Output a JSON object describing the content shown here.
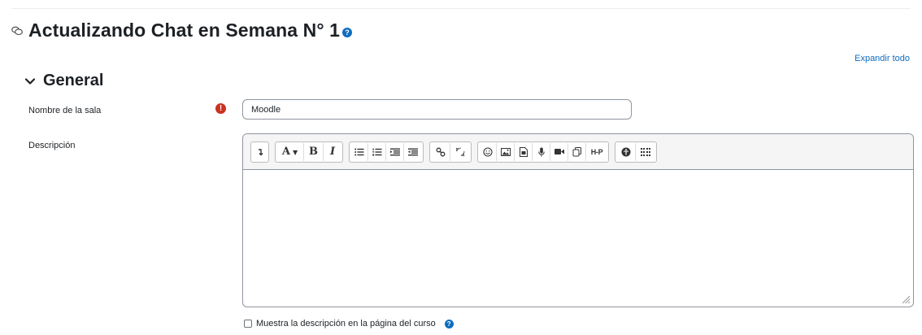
{
  "page": {
    "title": "Actualizando Chat en Semana N° 1",
    "title_icon": "chat-icon",
    "help_icon": "question-circle-icon"
  },
  "expand_all_label": "Expandir todo",
  "section": {
    "title": "General",
    "toggle_icon": "chevron-down-icon"
  },
  "fields": {
    "name": {
      "label": "Nombre de la sala",
      "value": "Moodle",
      "required_icon": "exclamation-circle-icon"
    },
    "description": {
      "label": "Descripción",
      "value": ""
    }
  },
  "editor_toolbar": {
    "groups": [
      [
        {
          "name": "collapse-toolbar-icon",
          "text": "↴"
        }
      ],
      [
        {
          "name": "font-style-icon",
          "text": "A▾"
        },
        {
          "name": "bold-icon",
          "text": "B"
        },
        {
          "name": "italic-icon",
          "text": "I"
        }
      ],
      [
        {
          "name": "unordered-list-icon"
        },
        {
          "name": "ordered-list-icon"
        },
        {
          "name": "outdent-icon"
        },
        {
          "name": "indent-icon"
        }
      ],
      [
        {
          "name": "link-icon"
        },
        {
          "name": "unlink-icon"
        }
      ],
      [
        {
          "name": "emoji-icon"
        },
        {
          "name": "image-icon"
        },
        {
          "name": "media-icon"
        },
        {
          "name": "record-audio-icon"
        },
        {
          "name": "record-video-icon"
        },
        {
          "name": "manage-files-icon"
        },
        {
          "name": "h5p-icon",
          "text": "H-P"
        }
      ],
      [
        {
          "name": "accessibility-checker-icon"
        },
        {
          "name": "screenreader-helper-icon"
        }
      ]
    ]
  },
  "show_description_checkbox": {
    "label": "Muestra la descripción en la página del curso",
    "checked": false,
    "help_icon": "question-circle-icon"
  },
  "colors": {
    "link": "#0f6cbf",
    "required": "#ca3120",
    "border": "#8f959e"
  }
}
